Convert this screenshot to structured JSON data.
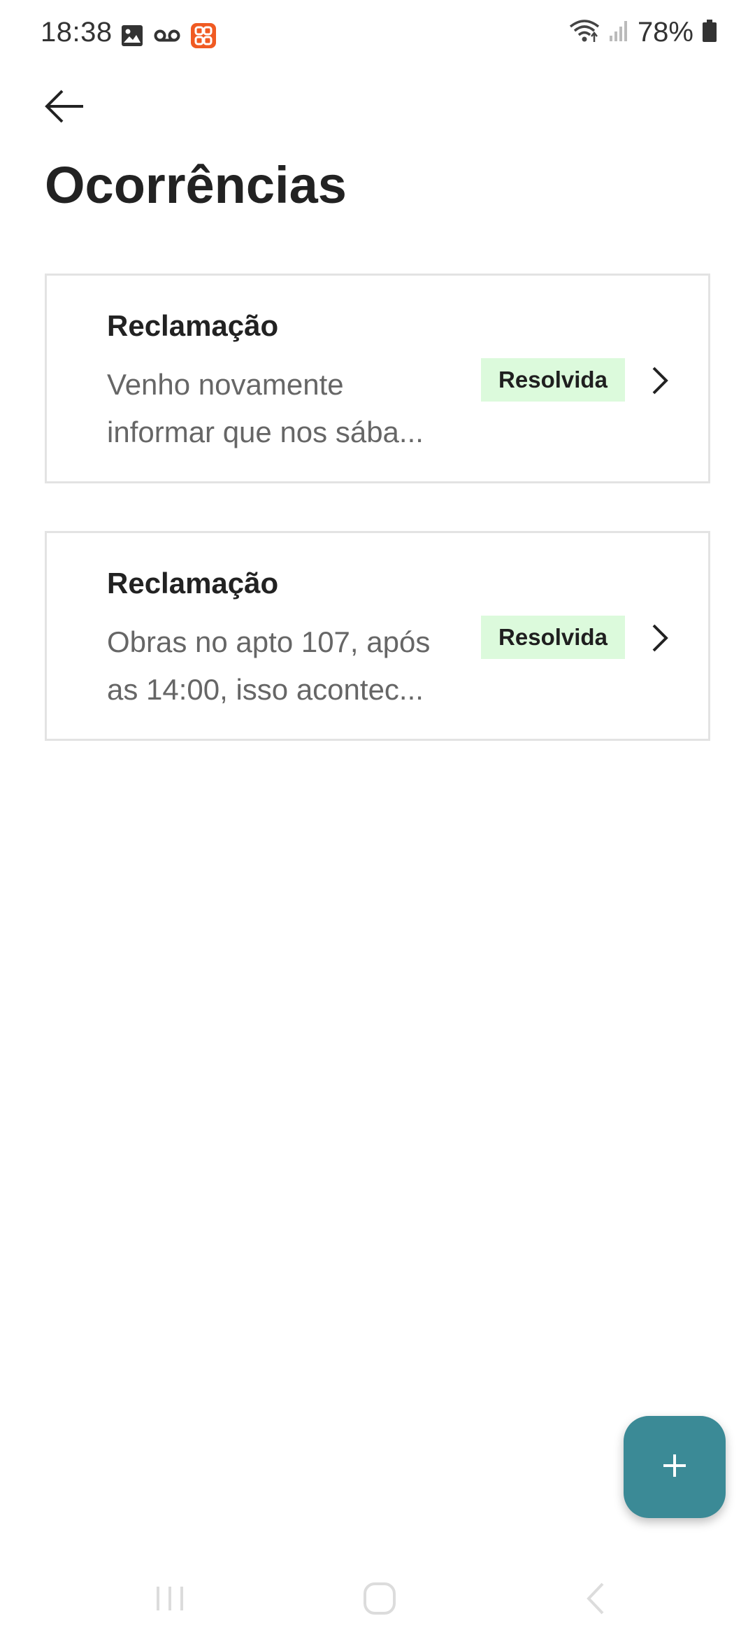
{
  "status_bar": {
    "time": "18:38",
    "battery": "78%",
    "left_icons": [
      "image-icon",
      "voicemail-icon",
      "app-notification-icon"
    ],
    "right_icons": [
      "wifi-icon",
      "signal-icon",
      "battery-icon"
    ]
  },
  "header": {
    "back_icon": "arrow-left-icon",
    "title": "Ocorrências"
  },
  "occurrences": [
    {
      "type": "Reclamação",
      "description": "Venho novamente informar que nos sába...",
      "status": "Resolvida"
    },
    {
      "type": "Reclamação",
      "description": "Obras no apto 107, após as 14:00, isso acontec...",
      "status": "Resolvida"
    }
  ],
  "fab": {
    "icon": "plus-icon"
  },
  "colors": {
    "accent": "#3b8a96",
    "badge_bg": "#dcfadc",
    "card_border": "#e3e3e3",
    "notification_icon": "#f05a22"
  },
  "nav_bar": {
    "icons": [
      "recent-apps-icon",
      "home-icon",
      "back-nav-icon"
    ]
  }
}
